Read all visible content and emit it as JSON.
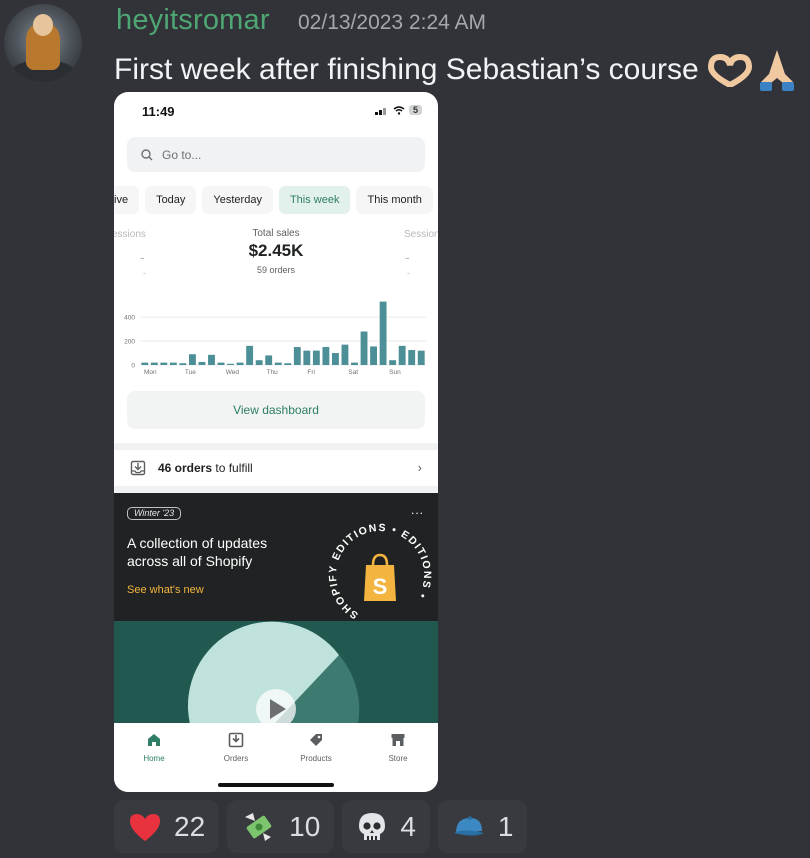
{
  "message": {
    "username": "heyitsromar",
    "timestamp": "02/13/2023 2:24 AM",
    "text": "First week after finishing Sebastian’s course",
    "emojis": [
      "heart-hands-emoji",
      "folded-hands-emoji"
    ]
  },
  "phone": {
    "status_time": "11:49",
    "battery": "5",
    "search_placeholder": "Go to...",
    "tabs": [
      {
        "label": "ive",
        "active": false
      },
      {
        "label": "Today",
        "active": false
      },
      {
        "label": "Yesterday",
        "active": false
      },
      {
        "label": "This week",
        "active": true
      },
      {
        "label": "This month",
        "active": false
      }
    ],
    "metrics": {
      "left_label": "essions",
      "left_value": "-",
      "left_sub": "-",
      "center_label": "Total sales",
      "center_value": "$2.45K",
      "center_sub": "59 orders",
      "right_label": "Session",
      "right_value": "-",
      "right_sub": "-"
    },
    "dashboard_button": "View dashboard",
    "orders": {
      "count": "46 orders",
      "suffix": " to fulfill"
    },
    "promo": {
      "badge": "Winter '23",
      "dots": "...",
      "title": "A collection of updates across all of Shopify",
      "link": "See what's new",
      "seal_text": "SHOPIFY EDITIONS • EDITIONS •"
    },
    "nav": [
      {
        "label": "Home",
        "icon": "home-icon",
        "active": true
      },
      {
        "label": "Orders",
        "icon": "orders-icon",
        "active": false
      },
      {
        "label": "Products",
        "icon": "tag-icon",
        "active": false
      },
      {
        "label": "Store",
        "icon": "store-icon",
        "active": false
      }
    ]
  },
  "chart_data": {
    "type": "bar",
    "categories": [
      "Mon",
      "Tue",
      "Wed",
      "Thu",
      "Fri",
      "Sat",
      "Sun"
    ],
    "values": [
      20,
      20,
      20,
      20,
      15,
      90,
      25,
      85,
      20,
      10,
      20,
      160,
      40,
      80,
      20,
      15,
      150,
      120,
      120,
      150,
      100,
      170,
      20,
      280,
      155,
      530,
      40,
      160,
      125,
      120
    ],
    "yticks": [
      0,
      200,
      400
    ],
    "ylim": [
      0,
      560
    ],
    "colors": {
      "bar": "#4c8f96"
    }
  },
  "reactions": [
    {
      "icon": "heart-emoji",
      "count": "22"
    },
    {
      "icon": "money-with-wings-emoji",
      "count": "10"
    },
    {
      "icon": "skull-emoji",
      "count": "4"
    },
    {
      "icon": "blue-cap-emoji",
      "count": "1"
    }
  ]
}
